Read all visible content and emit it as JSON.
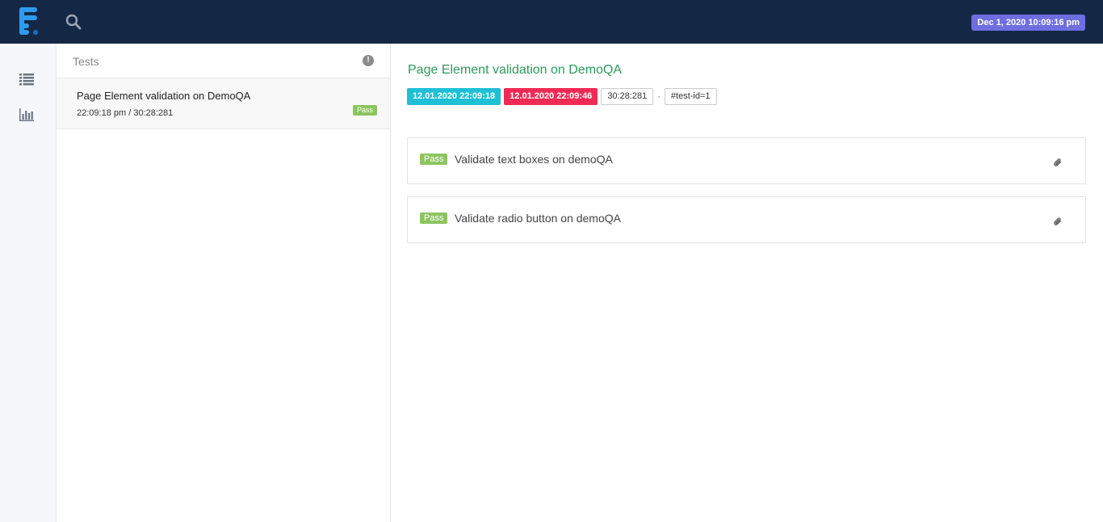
{
  "header": {
    "logo_icon": "extent-logo-icon",
    "search_icon": "search-icon",
    "datetime": "Dec 1, 2020 10:09:16 pm",
    "datetime_color": "#6e6ee0",
    "background_color": "#142846"
  },
  "nav": {
    "items": [
      {
        "icon": "list-icon"
      },
      {
        "icon": "bar-chart-icon"
      }
    ]
  },
  "tests_panel": {
    "title": "Tests",
    "info_icon": "!",
    "items": [
      {
        "name": "Page Element validation on DemoQA",
        "meta": "22:09:18 pm / 30:28:281",
        "status": "Pass"
      }
    ]
  },
  "detail": {
    "title": "Page Element validation on DemoQA",
    "title_color": "#2e9a5e",
    "start_time": "12.01.2020 22:09:18",
    "end_time": "12.01.2020 22:09:46",
    "duration": "30:28:281",
    "separator": "·",
    "test_id": "#test-id=1",
    "steps": [
      {
        "status": "Pass",
        "name": "Validate text boxes on demoQA",
        "icon": "paperclip-icon"
      },
      {
        "status": "Pass",
        "name": "Validate radio button on demoQA",
        "icon": "paperclip-icon"
      }
    ],
    "colors": {
      "pass": "#8cc560",
      "start": "#1ec0d6",
      "end": "#ef2b55"
    }
  }
}
